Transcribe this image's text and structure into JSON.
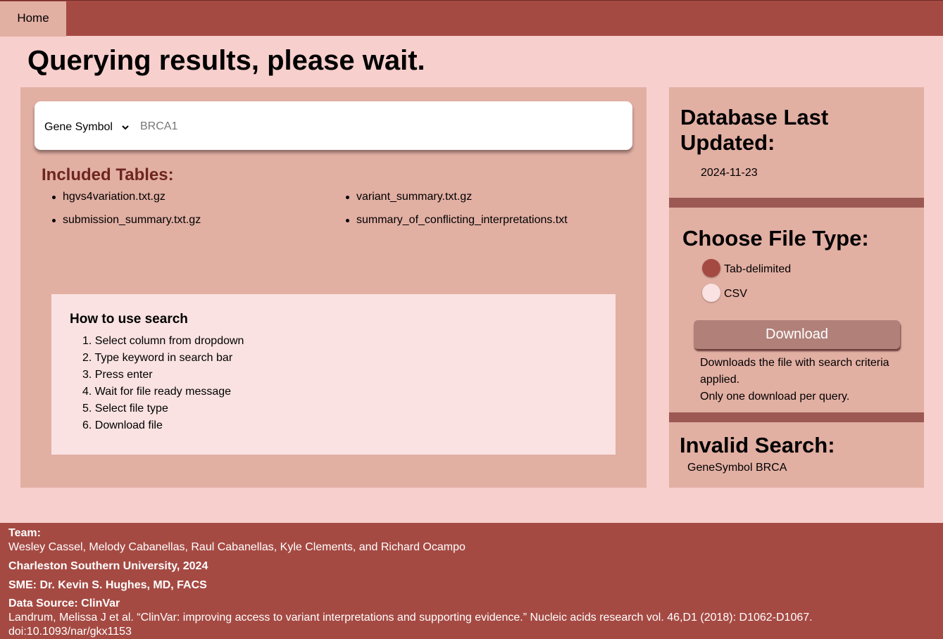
{
  "nav": {
    "home_label": "Home"
  },
  "page_title": "Querying results, please wait.",
  "search": {
    "column_selected": "Gene Symbol",
    "query_placeholder": "BRCA1"
  },
  "included_tables": {
    "heading": "Included Tables:",
    "items": [
      "hgvs4variation.txt.gz",
      "variant_summary.txt.gz",
      "submission_summary.txt.gz",
      "summary_of_conflicting_interpretations.txt"
    ]
  },
  "howto": {
    "title": "How to use search",
    "steps": [
      "1. Select column from dropdown",
      "2. Type keyword in search bar",
      "3. Press enter",
      "4. Wait for file ready message",
      "5. Select file type",
      "6. Download file"
    ]
  },
  "database": {
    "heading_line1": "Database Last",
    "heading_line2": "Updated:",
    "date": "2024-11-23"
  },
  "file_type": {
    "heading": "Choose File Type:",
    "options": [
      "Tab-delimited",
      "CSV"
    ],
    "selected": "Tab-delimited",
    "download_label": "Download",
    "note_line1": "Downloads the file with search criteria applied.",
    "note_line2": "Only one download per query."
  },
  "invalid": {
    "heading": "Invalid Search:",
    "text": "GeneSymbol BRCA"
  },
  "footer": {
    "team_heading": "Team:",
    "team_members": "Wesley Cassel, Melody Cabanellas, Raul Cabanellas, Kyle Clements, and Richard Ocampo",
    "university": "Charleston Southern University, 2024",
    "sme": "SME: Dr. Kevin S. Hughes, MD, FACS",
    "data_source": "Data Source: ClinVar",
    "citation": "Landrum, Melissa J et al. “ClinVar: improving access to variant interpretations and supporting evidence.” Nucleic acids research vol. 46,D1 (2018): D1062-D1067.",
    "doi": "doi:10.1093/nar/gkx1153"
  },
  "colors": {
    "nav_bar": "#a54a43",
    "page_bg": "#f7cfcd",
    "panel_bg": "#e2afa3",
    "radio_selected": "#a54a43",
    "radio_unselected": "#f9e2e1",
    "download_button": "#b08079"
  }
}
